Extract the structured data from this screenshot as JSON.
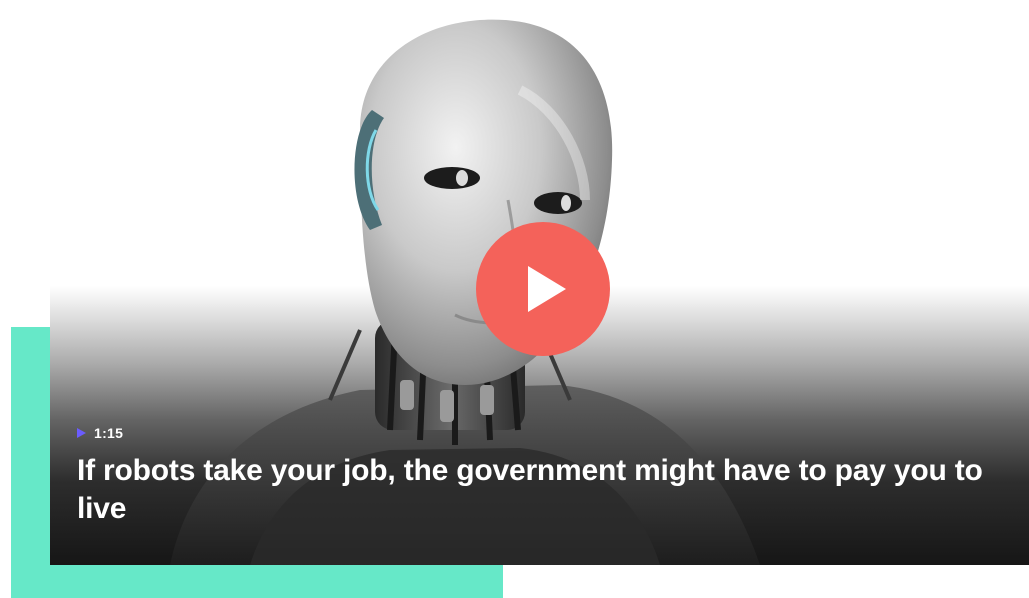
{
  "video": {
    "duration": "1:15",
    "title": "If robots take your job, the government might have to pay you to live",
    "thumbnail_subject": "humanoid-robot-icon",
    "play_icon": "play-icon",
    "duration_icon": "play-small-icon"
  },
  "colors": {
    "accent": "#66e8c8",
    "play_button": "#f4625a",
    "duration_icon": "#6b5cff",
    "title_text": "#ffffff"
  }
}
